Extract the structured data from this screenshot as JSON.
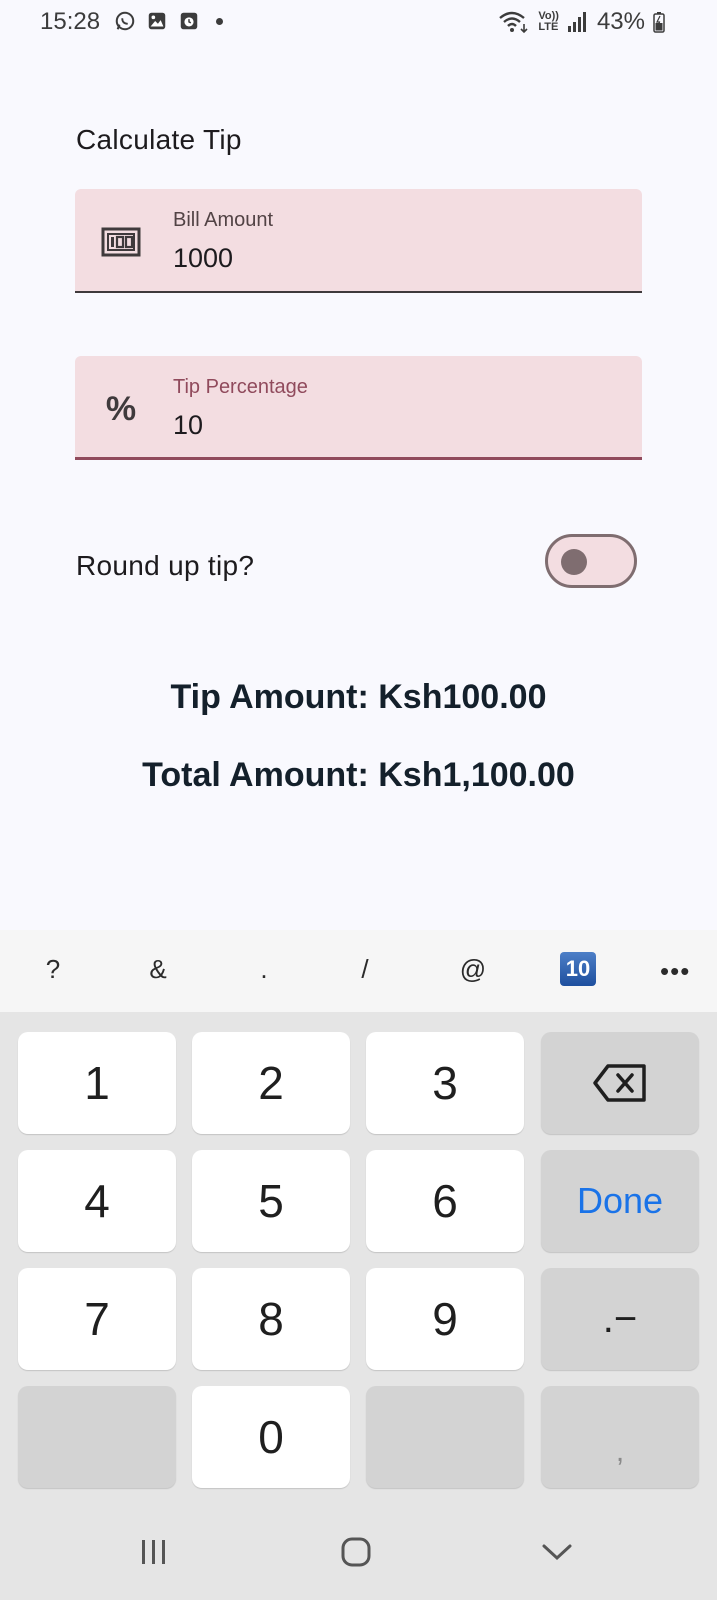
{
  "status_bar": {
    "time": "15:28",
    "network": "LTE",
    "volte": "Vo))",
    "battery": "43%"
  },
  "screen": {
    "title": "Calculate Tip",
    "bill_field": {
      "label": "Bill Amount",
      "value": "1000",
      "icon": "money-icon"
    },
    "tip_field": {
      "label": "Tip Percentage",
      "value": "10",
      "icon_text": "%",
      "focused": true
    },
    "round_up": {
      "label": "Round up tip?",
      "checked": false
    },
    "tip_amount": "Tip Amount: Ksh100.00",
    "total_amount": "Total Amount: Ksh1,100.00"
  },
  "keyboard": {
    "suggestions": [
      "?",
      "&",
      ".",
      "/",
      "@"
    ],
    "emoji_label": "10",
    "more": "•••",
    "keys": {
      "k1": "1",
      "k2": "2",
      "k3": "3",
      "k4": "4",
      "k5": "5",
      "k6": "6",
      "k7": "7",
      "k8": "8",
      "k9": "9",
      "k0": "0",
      "done": "Done",
      "decimal_minus": ".−",
      "comma": ","
    }
  },
  "colors": {
    "field_bg": "#f3dde1",
    "accent": "#904a5c",
    "background": "#f9f9fe",
    "done_blue": "#1a73e8"
  }
}
